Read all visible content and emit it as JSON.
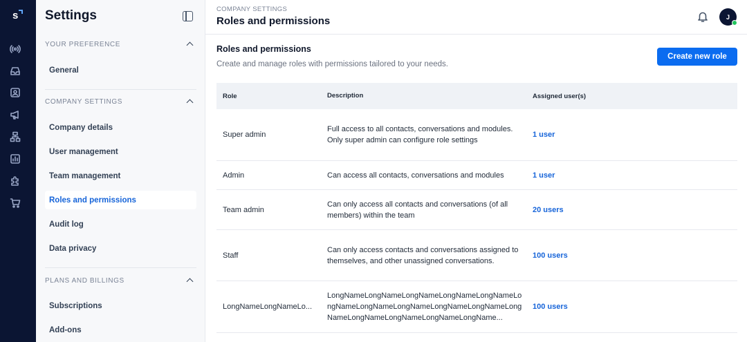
{
  "app": {
    "logo_letter": "s"
  },
  "sidebar": {
    "title": "Settings",
    "sections": [
      {
        "label": "YOUR PREFERENCE",
        "items": [
          "General"
        ]
      },
      {
        "label": "COMPANY SETTINGS",
        "items": [
          "Company details",
          "User management",
          "Team management",
          "Roles and permissions",
          "Audit log",
          "Data privacy"
        ]
      },
      {
        "label": "PLANS AND BILLINGS",
        "items": [
          "Subscriptions",
          "Add-ons"
        ]
      }
    ],
    "active_item": "Roles and permissions"
  },
  "header": {
    "breadcrumb": "COMPANY SETTINGS",
    "title": "Roles and permissions",
    "avatar_initial": "J"
  },
  "main": {
    "title": "Roles and permissions",
    "description": "Create and manage roles with permissions tailored to your needs.",
    "create_button": "Create new role",
    "table": {
      "columns": [
        "Role",
        "Description",
        "Assigned user(s)"
      ],
      "rows": [
        {
          "role": "Super admin",
          "description": "Full access to all contacts, conversations and modules. Only super admin can configure role settings",
          "assigned": "1 user"
        },
        {
          "role": "Admin",
          "description": "Can access all contacts, conversations and modules",
          "assigned": "1 user"
        },
        {
          "role": "Team admin",
          "description": "Can only access all contacts and conversations (of all members) within the team",
          "assigned": "20 users"
        },
        {
          "role": "Staff",
          "description": "Can only access contacts and conversations assigned to themselves, and other unassigned conversations.",
          "assigned": "100 users"
        },
        {
          "role": "LongNameLongNameLo...",
          "description": "LongNameLongNameLongNameLongNameLongNameLongNameLongNameLongNameLongNameLongNameLongNameLongNameLongNameLongNameLongName...",
          "assigned": "100 users"
        }
      ]
    }
  },
  "colors": {
    "rail": "#0b1533",
    "accent": "#0b6cf0",
    "link": "#1664d9",
    "online": "#22c55e"
  }
}
